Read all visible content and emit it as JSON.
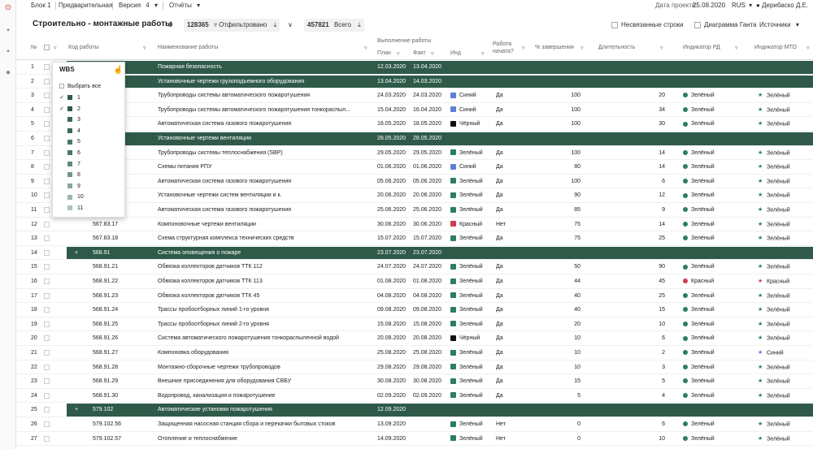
{
  "menu": {
    "block": "Блок 1",
    "preliminary": "Предварительная",
    "version_label": "Версия",
    "version_value": "4",
    "reports": "Отчёты",
    "project_date_label": "Дата проекта:",
    "project_date": "25.08.2020",
    "language": "RUS",
    "user": "Дерибаско Д.Е."
  },
  "toolbar": {
    "title": "Строительно - монтажные работы",
    "filtered_count": "128365",
    "filtered_label": "Отфильтровано",
    "total_count": "457821",
    "total_label": "Всего",
    "unlinked_label": "Несвязанные строки",
    "gantt_label": "Диаграмма Ганта",
    "sources_label": "Источники"
  },
  "columns": {
    "num": "№",
    "code": "Код работы",
    "name": "Наименование работы",
    "exec": "Выполнение работы",
    "plan": "План",
    "fact": "Факт",
    "ind": "Инд",
    "started": "Работа",
    "started2": "начата?",
    "pct": "% завершения",
    "duration": "Длительность",
    "rd": "Индикатор РД",
    "mto": "Индикатор МТО"
  },
  "wbs": {
    "title": "WBS",
    "select_all": "Выбрать все",
    "items": [
      {
        "label": "1",
        "checked": true,
        "color": "#2f5a49"
      },
      {
        "label": "2",
        "checked": true,
        "color": "#2f5a49"
      },
      {
        "label": "3",
        "checked": false,
        "color": "#3b6a55"
      },
      {
        "label": "4",
        "checked": false,
        "color": "#3b6a55"
      },
      {
        "label": "5",
        "checked": false,
        "color": "#4a7a64"
      },
      {
        "label": "6",
        "checked": false,
        "color": "#4a7a64"
      },
      {
        "label": "7",
        "checked": false,
        "color": "#5e8a76"
      },
      {
        "label": "8",
        "checked": false,
        "color": "#6f9884"
      },
      {
        "label": "9",
        "checked": false,
        "color": "#86a897"
      },
      {
        "label": "10",
        "checked": false,
        "color": "#9ab7a8"
      },
      {
        "label": "11",
        "checked": false,
        "color": "#aac3b6"
      }
    ]
  },
  "colors": {
    "group_band": "#2f5a49",
    "blue": "#5b7fd6",
    "black": "#111111",
    "green": "#2e7d5b",
    "red": "#d23b4a",
    "green_star": "#2e7d5b",
    "red_star": "#d23b4a",
    "blue_star": "#5b7fd6"
  },
  "rows": [
    {
      "n": "1",
      "group": true,
      "plus": "",
      "code": "",
      "name": "Пожарная безопасность",
      "plan": "12.03.2020",
      "fact": "13.04.2020"
    },
    {
      "n": "2",
      "group": true,
      "plus": "",
      "code": "",
      "name": "Установочные чертежи грузоподъемного оборудования",
      "plan": "13.04.2020",
      "fact": "14.03.2020"
    },
    {
      "n": "3",
      "code": "",
      "name": "Трубопроводы системы автоматического пожаротушения",
      "plan": "24.03.2020",
      "fact": "24.03.2020",
      "ind": "Синий",
      "ind_c": "blue",
      "started": "Да",
      "pct": "100",
      "dur": "20",
      "rd": "Зелёный",
      "rd_c": "green",
      "mto": "Зелёный",
      "mto_c": "green_star"
    },
    {
      "n": "4",
      "code": "",
      "name": "Трубопроводы системы автоматического пожаротушения тонкораспыл...",
      "plan": "15.04.2020",
      "fact": "16.04.2020",
      "ind": "Синий",
      "ind_c": "blue",
      "started": "Да",
      "pct": "100",
      "dur": "34",
      "rd": "Зелёный",
      "rd_c": "green",
      "mto": "Зелёный",
      "mto_c": "green_star"
    },
    {
      "n": "5",
      "code": "",
      "name": "Автоматическая система газового пожаротушения",
      "plan": "18.05.2020",
      "fact": "18.05.2020",
      "ind": "Чёрный",
      "ind_c": "black",
      "started": "Да",
      "pct": "100",
      "dur": "30",
      "rd": "Зелёный",
      "rd_c": "green",
      "mto": "Зелёный",
      "mto_c": "green_star"
    },
    {
      "n": "6",
      "group": true,
      "plus": "",
      "code": "",
      "name": "Установочные чертежи вентиляции",
      "plan": "28.05.2020",
      "fact": "28.05.2020"
    },
    {
      "n": "7",
      "code": "",
      "name": "Трубопроводы системы теплоснабжения (SBP)",
      "plan": "29.05.2020",
      "fact": "29.05.2020",
      "ind": "Зелёный",
      "ind_c": "green",
      "started": "Да",
      "pct": "100",
      "dur": "14",
      "rd": "Зелёный",
      "rd_c": "green",
      "mto": "Зелёный",
      "mto_c": "green_star"
    },
    {
      "n": "8",
      "code": "",
      "name": "Схемы питания РПУ",
      "plan": "01.06.2020",
      "fact": "01.06.2020",
      "ind": "Синий",
      "ind_c": "blue",
      "started": "Да",
      "pct": "80",
      "dur": "14",
      "rd": "Зелёный",
      "rd_c": "green",
      "mto": "Зелёный",
      "mto_c": "green_star"
    },
    {
      "n": "9",
      "code": "",
      "name": "Автоматическая система газового пожаротушения",
      "plan": "05.06.2020",
      "fact": "05.06.2020",
      "ind": "Зелёный",
      "ind_c": "green",
      "started": "Да",
      "pct": "100",
      "dur": "6",
      "rd": "Зелёный",
      "rd_c": "green",
      "mto": "Зелёный",
      "mto_c": "green_star"
    },
    {
      "n": "10",
      "code": "",
      "name": "Установочные чертежи систем вентиляции и к.",
      "plan": "20.06.2020",
      "fact": "20.06.2020",
      "ind": "Зелёный",
      "ind_c": "green",
      "started": "Да",
      "pct": "90",
      "dur": "12",
      "rd": "Зелёный",
      "rd_c": "green",
      "mto": "Зелёный",
      "mto_c": "green_star"
    },
    {
      "n": "11",
      "code": "",
      "name": "Автоматическая система газового пожаротушения",
      "plan": "25.06.2020",
      "fact": "25.06.2020",
      "ind": "Зелёный",
      "ind_c": "green",
      "started": "Да",
      "pct": "85",
      "dur": "9",
      "rd": "Зелёный",
      "rd_c": "green",
      "mto": "Зелёный",
      "mto_c": "green_star"
    },
    {
      "n": "12",
      "code": "567.83.17",
      "name": "Компоновочные чертежи вентиляции",
      "plan": "30.06.2020",
      "fact": "30.06.2020",
      "ind": "Красный",
      "ind_c": "red",
      "started": "Нет",
      "pct": "75",
      "dur": "14",
      "rd": "Зелёный",
      "rd_c": "green",
      "mto": "Зелёный",
      "mto_c": "green_star"
    },
    {
      "n": "13",
      "code": "567.83.18",
      "name": "Схема структурная комплекса технических средств",
      "plan": "15.07.2020",
      "fact": "15.07.2020",
      "ind": "Зелёный",
      "ind_c": "green",
      "started": "Да",
      "pct": "75",
      "dur": "25",
      "rd": "Зелёный",
      "rd_c": "green",
      "mto": "Зелёный",
      "mto_c": "green_star"
    },
    {
      "n": "14",
      "group": true,
      "plus": "+",
      "code": "568.91",
      "name": "Система оповещения о пожаре",
      "plan": "23.07.2020",
      "fact": "23.07.2020"
    },
    {
      "n": "15",
      "code": "568.91.21",
      "name": "Обвязка коллекторов датчиков ТТК 112",
      "plan": "24.07.2020",
      "fact": "24.07.2020",
      "ind": "Зелёный",
      "ind_c": "green",
      "started": "Да",
      "pct": "50",
      "dur": "90",
      "rd": "Зелёный",
      "rd_c": "green",
      "mto": "Зелёный",
      "mto_c": "green_star"
    },
    {
      "n": "16",
      "code": "568.91.22",
      "name": "Обвязка коллекторов датчиков ТТК 113",
      "plan": "01.08.2020",
      "fact": "01.08.2020",
      "ind": "Зелёный",
      "ind_c": "green",
      "started": "Да",
      "pct": "44",
      "dur": "45",
      "rd": "Красный",
      "rd_c": "red",
      "mto": "Красный",
      "mto_c": "red_star"
    },
    {
      "n": "17",
      "code": "568.91.23",
      "name": "Обвязка коллекторов датчиков ТТК 45",
      "plan": "04.08.2020",
      "fact": "04.08.2020",
      "ind": "Зелёный",
      "ind_c": "green",
      "started": "Да",
      "pct": "40",
      "dur": "25",
      "rd": "Зелёный",
      "rd_c": "green",
      "mto": "Зелёный",
      "mto_c": "green_star"
    },
    {
      "n": "18",
      "code": "568.91.24",
      "name": "Трассы пробоотборных линий 1-го уровня",
      "plan": "09.08.2020",
      "fact": "09.08.2020",
      "ind": "Зелёный",
      "ind_c": "green",
      "started": "Да",
      "pct": "40",
      "dur": "15",
      "rd": "Зелёный",
      "rd_c": "green",
      "mto": "Зелёный",
      "mto_c": "green_star"
    },
    {
      "n": "19",
      "code": "568.91.25",
      "name": "Трассы пробоотборных линий 2-го уровня",
      "plan": "15.08.2020",
      "fact": "15.08.2020",
      "ind": "Зелёный",
      "ind_c": "green",
      "started": "Да",
      "pct": "20",
      "dur": "10",
      "rd": "Зелёный",
      "rd_c": "green",
      "mto": "Зелёный",
      "mto_c": "green_star"
    },
    {
      "n": "20",
      "code": "568.91.26",
      "name": "Система автоматического пожаротушения тонкораспыленной водой",
      "plan": "20.08.2020",
      "fact": "20.08.2020",
      "ind": "Чёрный",
      "ind_c": "black",
      "started": "Да",
      "pct": "10",
      "dur": "6",
      "rd": "Зелёный",
      "rd_c": "green",
      "mto": "Зелёный",
      "mto_c": "green_star"
    },
    {
      "n": "21",
      "code": "568.91.27",
      "name": "Компоновка оборудования",
      "plan": "25.08.2020",
      "fact": "25.08.2020",
      "ind": "Зелёный",
      "ind_c": "green",
      "started": "Да",
      "pct": "10",
      "dur": "2",
      "rd": "Зелёный",
      "rd_c": "green",
      "mto": "Синий",
      "mto_c": "blue_star"
    },
    {
      "n": "22",
      "code": "568.91.28",
      "name": "Монтажно-сборочные чертежи трубопроводов",
      "plan": "29.08.2020",
      "fact": "29.08.2020",
      "ind": "Зелёный",
      "ind_c": "green",
      "started": "Да",
      "pct": "10",
      "dur": "3",
      "rd": "Зелёный",
      "rd_c": "green",
      "mto": "Зелёный",
      "mto_c": "green_star"
    },
    {
      "n": "23",
      "code": "568.91.29",
      "name": "Внешние присоединения для оборудования СВБУ",
      "plan": "30.08.2020",
      "fact": "30.08.2020",
      "ind": "Зелёный",
      "ind_c": "green",
      "started": "Да",
      "pct": "15",
      "dur": "5",
      "rd": "Зелёный",
      "rd_c": "green",
      "mto": "Зелёный",
      "mto_c": "green_star"
    },
    {
      "n": "24",
      "code": "568.91.30",
      "name": "Водопровод, канализация и пожаротушение",
      "plan": "02.09.2020",
      "fact": "02.09.2020",
      "ind": "Зелёный",
      "ind_c": "green",
      "started": "Да",
      "pct": "5",
      "dur": "4",
      "rd": "Зелёный",
      "rd_c": "green",
      "mto": "Зелёный",
      "mto_c": "green_star"
    },
    {
      "n": "25",
      "group": true,
      "plus": "+",
      "code": "579.102",
      "name": "Автоматические установки пожаротушения",
      "plan": "12.09.2020",
      "fact": ""
    },
    {
      "n": "26",
      "code": "579.102.56",
      "name": "Защищенная насосная станция сбора и перекачки бытовых стоков",
      "plan": "13.09.2020",
      "fact": "",
      "ind": "Зелёный",
      "ind_c": "green",
      "started": "Нет",
      "pct": "0",
      "dur": "6",
      "rd": "Зелёный",
      "rd_c": "green",
      "mto": "Зелёный",
      "mto_c": "green_star"
    },
    {
      "n": "27",
      "code": "579.102.57",
      "name": "Отопление и теплоснабжение",
      "plan": "14.09.2020",
      "fact": "",
      "ind": "Зелёный",
      "ind_c": "green",
      "started": "Нет",
      "pct": "0",
      "dur": "10",
      "rd": "Зелёный",
      "rd_c": "green",
      "mto": "Зелёный",
      "mto_c": "green_star"
    }
  ]
}
